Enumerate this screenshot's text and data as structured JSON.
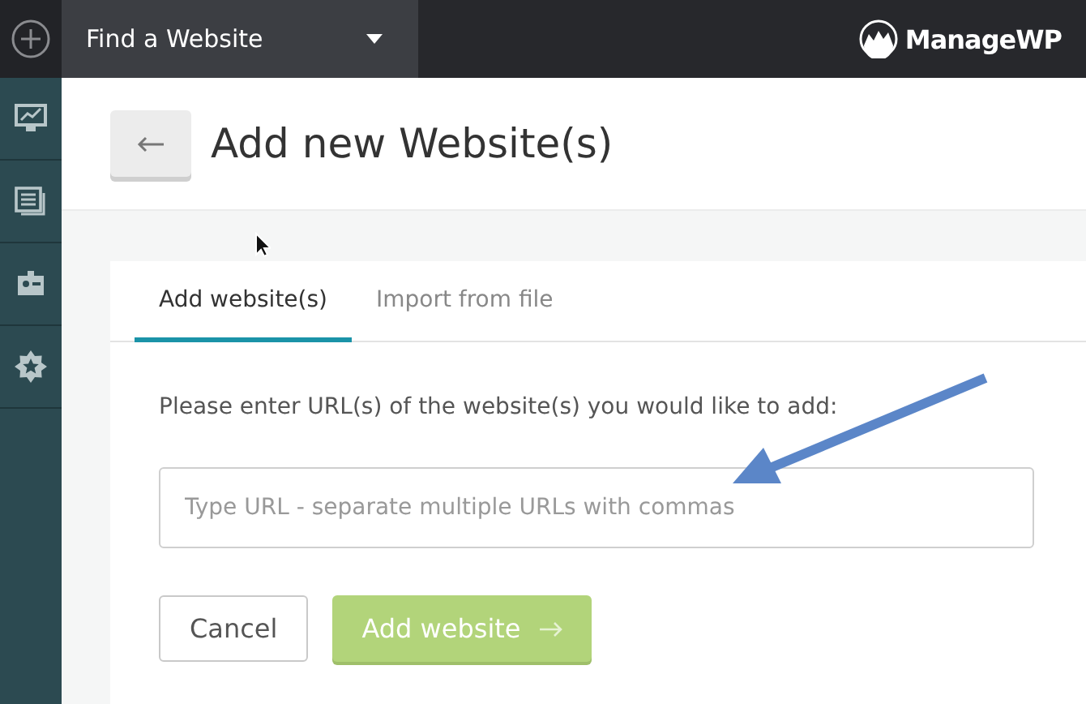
{
  "topbar": {
    "site_select": {
      "placeholder": "Find a Website"
    },
    "logo": "ManageWP"
  },
  "sidebar": {
    "items": [
      {
        "kind": "dashboard"
      },
      {
        "kind": "list"
      },
      {
        "kind": "badge"
      },
      {
        "kind": "star"
      }
    ]
  },
  "page": {
    "title": "Add new Website(s)"
  },
  "tabs": [
    {
      "label": "Add website(s)",
      "selected": true
    },
    {
      "label": "Import from file",
      "selected": false
    }
  ],
  "form": {
    "prompt": "Please enter URL(s) of the website(s) you would like to add:",
    "url_field": {
      "placeholder": "Type URL - separate multiple URLs with commas"
    },
    "buttons": [
      {
        "kind": "secondary",
        "label": "Cancel",
        "disabled": false
      },
      {
        "kind": "primary",
        "label": "Add website",
        "disabled": true
      }
    ]
  }
}
